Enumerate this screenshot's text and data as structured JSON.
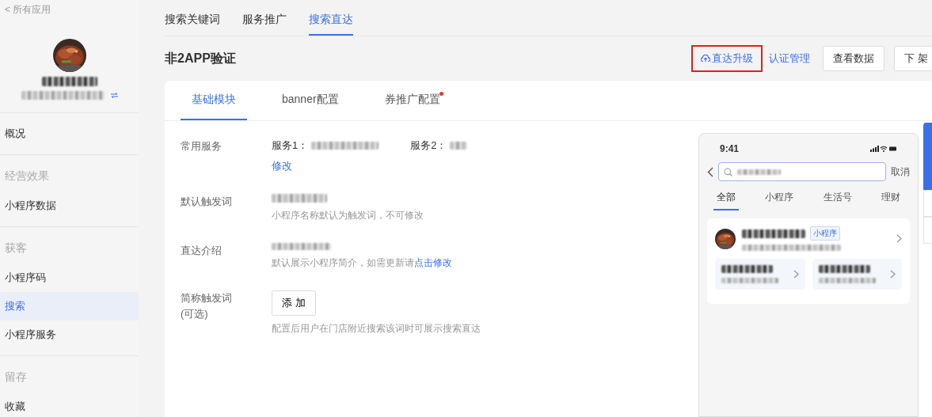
{
  "sidebar": {
    "back_link": "< 所有应用",
    "sections": [
      {
        "items": [
          {
            "label": "概况",
            "selected": false
          }
        ]
      },
      {
        "heading": "经营效果",
        "items": [
          {
            "label": "小程序数据",
            "selected": false
          }
        ]
      },
      {
        "heading": "获客",
        "items": [
          {
            "label": "小程序码",
            "selected": false
          },
          {
            "label": "搜索",
            "selected": true
          },
          {
            "label": "小程序服务",
            "selected": false
          }
        ]
      },
      {
        "heading": "留存",
        "items": [
          {
            "label": "收藏",
            "selected": false
          }
        ]
      }
    ]
  },
  "top_tabs": [
    {
      "label": "搜索关键词",
      "selected": false
    },
    {
      "label": "服务推广",
      "selected": false
    },
    {
      "label": "搜索直达",
      "selected": true
    }
  ],
  "page_title": "非2APP验证",
  "actions": [
    {
      "kind": "link",
      "label": "直达升级",
      "highlighted": true
    },
    {
      "kind": "link",
      "label": "认证管理",
      "highlighted": false
    },
    {
      "kind": "button",
      "label": "查看数据"
    },
    {
      "kind": "button",
      "label": "下 架"
    }
  ],
  "card_tabs": [
    {
      "label": "基础模块",
      "selected": true,
      "dot": false
    },
    {
      "label": "banner配置",
      "selected": false,
      "dot": false
    },
    {
      "label": "券推广配置",
      "selected": false,
      "dot": true
    }
  ],
  "form": {
    "common_services": {
      "label": "常用服务",
      "services": [
        "服务1：",
        "服务2："
      ],
      "link": "修改"
    },
    "default_trigger": {
      "label": "默认触发词",
      "hint": "小程序名称默认为触发词，不可修改"
    },
    "intro": {
      "label": "直达介绍",
      "hint": "默认展示小程序简介，如需更新请",
      "link": "点击修改"
    },
    "short_trigger": {
      "label": "简称触发词 (可选)",
      "button": "添 加",
      "hint": "配置后用户在门店附近搜索该词时可展示搜索直达"
    }
  },
  "phone": {
    "time": "9:41",
    "cancel": "取消",
    "tabs": [
      {
        "label": "全部",
        "selected": true
      },
      {
        "label": "小程序",
        "selected": false
      },
      {
        "label": "生活号",
        "selected": false
      },
      {
        "label": "理财",
        "selected": false
      }
    ],
    "result": {
      "tag": "小程序"
    }
  }
}
